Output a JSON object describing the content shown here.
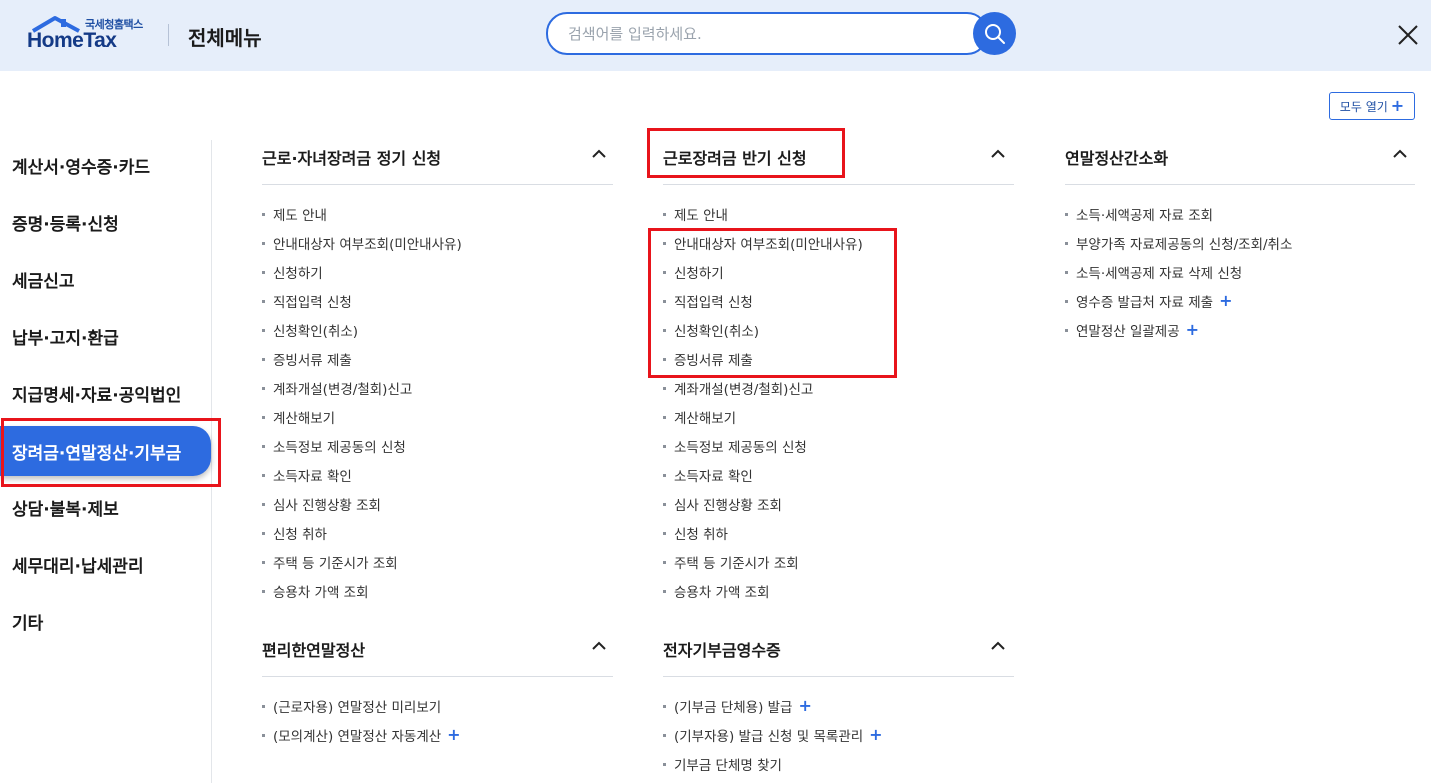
{
  "header": {
    "logo_sub": "국세청홈택스",
    "logo_main": "HomeTax",
    "title": "전체메뉴",
    "search_placeholder": "검색어를 입력하세요.",
    "search_icon": "search-icon",
    "close_icon": "close-icon"
  },
  "expand_all_label": "모두 열기",
  "left_nav": {
    "items": [
      {
        "label": "계산서·영수증·카드"
      },
      {
        "label": "증명·등록·신청"
      },
      {
        "label": "세금신고"
      },
      {
        "label": "납부·고지·환급"
      },
      {
        "label": "지급명세·자료·공익법인"
      },
      {
        "label": "장려금·연말정산·기부금",
        "active": true
      },
      {
        "label": "상담·불복·제보"
      },
      {
        "label": "세무대리·납세관리"
      },
      {
        "label": "기타"
      }
    ]
  },
  "sections": {
    "s1": {
      "title": "근로·자녀장려금 정기 신청",
      "items": [
        "제도 안내",
        "안내대상자 여부조회(미안내사유)",
        "신청하기",
        "직접입력 신청",
        "신청확인(취소)",
        "증빙서류 제출",
        "계좌개설(변경/철회)신고",
        "계산해보기",
        "소득정보 제공동의 신청",
        "소득자료 확인",
        "심사 진행상황 조회",
        "신청 취하",
        "주택 등 기준시가 조회",
        "승용차 가액 조회"
      ]
    },
    "s2": {
      "title": "근로장려금 반기 신청",
      "items": [
        "제도 안내",
        "안내대상자 여부조회(미안내사유)",
        "신청하기",
        "직접입력 신청",
        "신청확인(취소)",
        "증빙서류 제출",
        "계좌개설(변경/철회)신고",
        "계산해보기",
        "소득정보 제공동의 신청",
        "소득자료 확인",
        "심사 진행상황 조회",
        "신청 취하",
        "주택 등 기준시가 조회",
        "승용차 가액 조회"
      ]
    },
    "s3": {
      "title": "연말정산간소화",
      "items": [
        "소득·세액공제 자료 조회",
        "부양가족 자료제공동의 신청/조회/취소",
        "소득·세액공제 자료 삭제 신청",
        "영수증 발급처 자료 제출",
        "연말정산 일괄제공"
      ]
    },
    "s4": {
      "title": "편리한연말정산",
      "items": [
        "(근로자용) 연말정산 미리보기",
        "(모의계산) 연말정산 자동계산"
      ]
    },
    "s5": {
      "title": "전자기부금영수증",
      "items": [
        "(기부금 단체용) 발급",
        "(기부자용) 발급 신청 및 목록관리",
        "기부금 단체명 찾기"
      ]
    }
  },
  "plus_symbol": "+",
  "accent_color": "#2d6be0",
  "highlight_color": "#e8141b"
}
